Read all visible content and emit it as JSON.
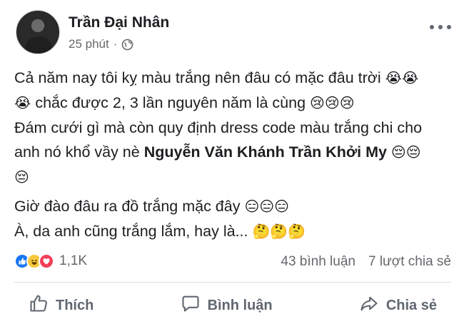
{
  "post": {
    "author": "Trần Đại Nhân",
    "time": "25 phút",
    "separator": "·",
    "lines": {
      "l1": "Cả năm nay tôi kỵ màu trắng nên đâu có mặc đâu trời",
      "l1_emoji": "😭😭",
      "l2_emoji": "😭",
      "l2": " chắc được 2, 3 lần nguyên năm là cùng ",
      "l2_emoji_end": "😢😢😢",
      "l3": "Đám cưới gì mà còn quy định dress code màu trắng chi cho anh nó khổ vầy nè ",
      "mention_1": "Nguyễn Văn Khánh",
      "mention_2": "Trần Khởi My",
      "l3_emoji": "😔😔",
      "l4_emoji": "😔",
      "l5": "Giờ đào đâu ra đồ trắng mặc đây ",
      "l5_emoji": "😑😑😑",
      "l6": "À, da anh cũng trắng lắm, hay là... ",
      "l6_emoji": "🤔🤔🤔"
    }
  },
  "stats": {
    "reaction_count": "1,1K",
    "comments": "43 bình luận",
    "shares": "7 lượt chia sẻ"
  },
  "actions": {
    "like": "Thích",
    "comment": "Bình luận",
    "share": "Chia sẻ"
  },
  "colors": {
    "like": "#1877f2",
    "haha": "#f7c83b",
    "love": "#f33e58",
    "muted": "#65676b"
  },
  "icons": [
    "globe-icon",
    "more-icon",
    "like-icon",
    "comment-icon",
    "share-icon"
  ]
}
